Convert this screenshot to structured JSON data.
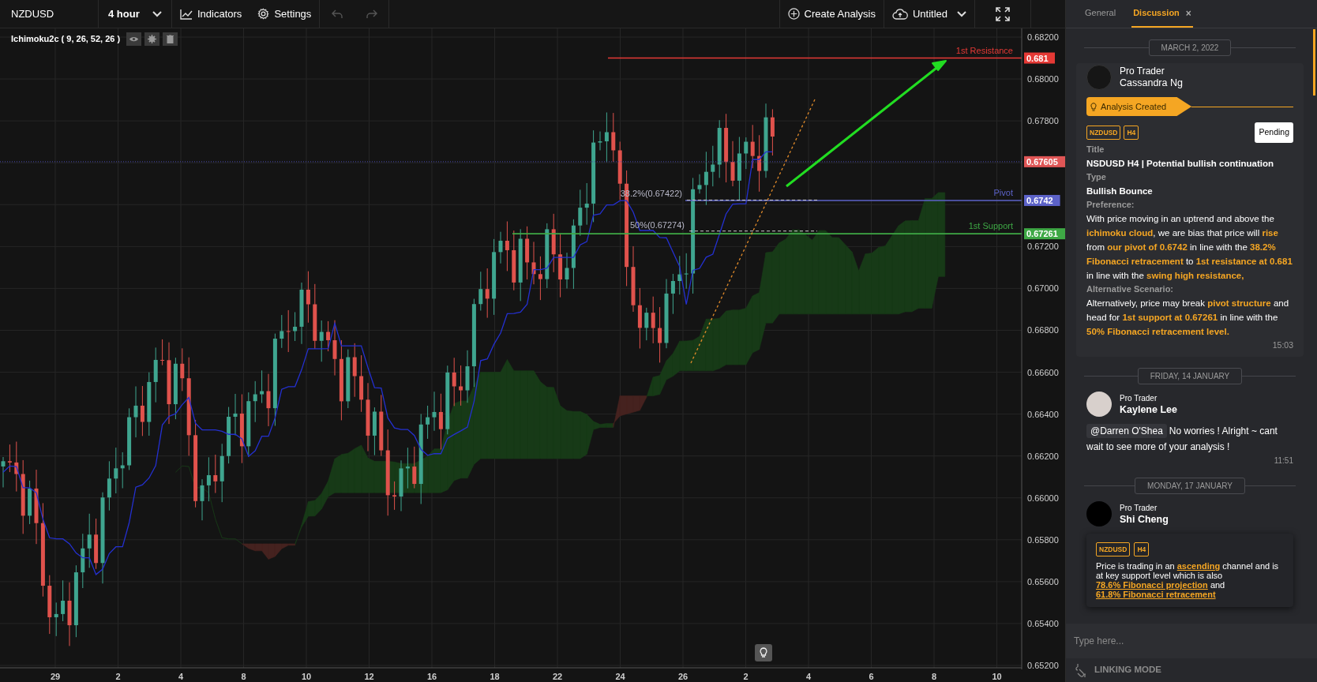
{
  "toolbar": {
    "symbol": "NZDUSD",
    "timeframe": "4 hour",
    "indicators": "Indicators",
    "settings": "Settings",
    "undo_enabled": false,
    "redo_enabled": false,
    "create_analysis": "Create Analysis",
    "layout_name": "Untitled"
  },
  "chart": {
    "indicator_legend": "Ichimoku2c ( 9, 26, 52, 26 )",
    "y_axis": [
      "0.68200",
      "0.68000",
      "0.67800",
      "0.67200",
      "0.67000",
      "0.66800",
      "0.66600",
      "0.66400",
      "0.66200",
      "0.66000",
      "0.65800",
      "0.65600",
      "0.65400",
      "0.65200"
    ],
    "x_axis": [
      "29",
      "2",
      "4",
      "8",
      "10",
      "12",
      "16",
      "18",
      "22",
      "24",
      "26",
      "2",
      "4",
      "6",
      "8",
      "10"
    ],
    "levels": [
      {
        "label": "1st Resistance",
        "price_tag": "0.681",
        "color": "#e53935"
      },
      {
        "label": "Pivot",
        "price_tag": "0.6742",
        "color": "#5c62c8"
      },
      {
        "label": "1st Support",
        "price_tag": "0.67261",
        "color": "#3ea845"
      }
    ],
    "last_price_tag": "0.67605",
    "fib_labels": [
      "38.2%(0.67422)",
      "50%(0.67274)"
    ]
  },
  "panel": {
    "tabs": [
      {
        "label": "General",
        "selected": false
      },
      {
        "label": "Discussion",
        "selected": true,
        "close_glyph": "×"
      }
    ],
    "messages": [
      {
        "kind": "analysis",
        "date": "MARCH 2, 2022",
        "role": "Pro Trader",
        "name": "Cassandra Ng",
        "banner": "Analysis Created",
        "tags": [
          "NZDUSD",
          "H4"
        ],
        "status": "Pending",
        "time": "15:03",
        "fields": [
          {
            "label": "Title",
            "segments": [
              {
                "text": "NSDUSD H4 | Potential bullish continuation",
                "highlight": false
              }
            ]
          },
          {
            "label": "Type",
            "segments": [
              {
                "text": "Bullish Bounce",
                "highlight": false
              }
            ]
          },
          {
            "label": "Preference:",
            "segments": [
              {
                "text": "With price moving in an uptrend and above the ",
                "highlight": false
              },
              {
                "text": "ichimoku cloud",
                "highlight": true
              },
              {
                "text": ", we are bias that price will ",
                "highlight": false
              },
              {
                "text": "rise",
                "highlight": true
              },
              {
                "text": " from ",
                "highlight": false
              },
              {
                "text": "our pivot of 0.6742",
                "highlight": true
              },
              {
                "text": " in line with the ",
                "highlight": false
              },
              {
                "text": "38.2% Fibonacci retracement",
                "highlight": true
              },
              {
                "text": " to ",
                "highlight": false
              },
              {
                "text": "1st resistance at 0.681",
                "highlight": true
              },
              {
                "text": " in line with the ",
                "highlight": false
              },
              {
                "text": "swing high resistance,",
                "highlight": true
              }
            ]
          },
          {
            "label": "Alternative Scenario:",
            "segments": [
              {
                "text": "Alternatively, price may break ",
                "highlight": false
              },
              {
                "text": "pivot structure",
                "highlight": true
              },
              {
                "text": " and head for ",
                "highlight": false
              },
              {
                "text": "1st support at 0.67261",
                "highlight": true
              },
              {
                "text": " in line with the ",
                "highlight": false
              },
              {
                "text": "50% Fibonacci retracement level.",
                "highlight": true
              }
            ]
          }
        ]
      },
      {
        "kind": "comment",
        "date": "FRIDAY, 14 JANUARY",
        "role": "Pro Trader",
        "name": "Kaylene Lee",
        "mention": "@Darren O'Shea",
        "text": "No worries ! Alright ~ cant wait to see more of your analysis !",
        "time": "11:51"
      },
      {
        "kind": "idea",
        "date": "MONDAY, 17 JANUARY",
        "role": "Pro Trader",
        "name": "Shi Cheng",
        "tags": [
          "NZDUSD",
          "H4"
        ],
        "segments": [
          {
            "text": "Price is trading in an ",
            "highlight": false
          },
          {
            "text": "ascending",
            "highlight": true
          },
          {
            "text": " channel and is at key support level which is also ",
            "highlight": false
          },
          {
            "text": "78.6% Fibonacci projection",
            "highlight": true
          },
          {
            "text": " and ",
            "highlight": false
          },
          {
            "text": "61.8% Fibonacci retracement",
            "highlight": true
          }
        ]
      }
    ],
    "input": {
      "placeholder": "Type here..."
    },
    "footer": "LINKING MODE"
  }
}
